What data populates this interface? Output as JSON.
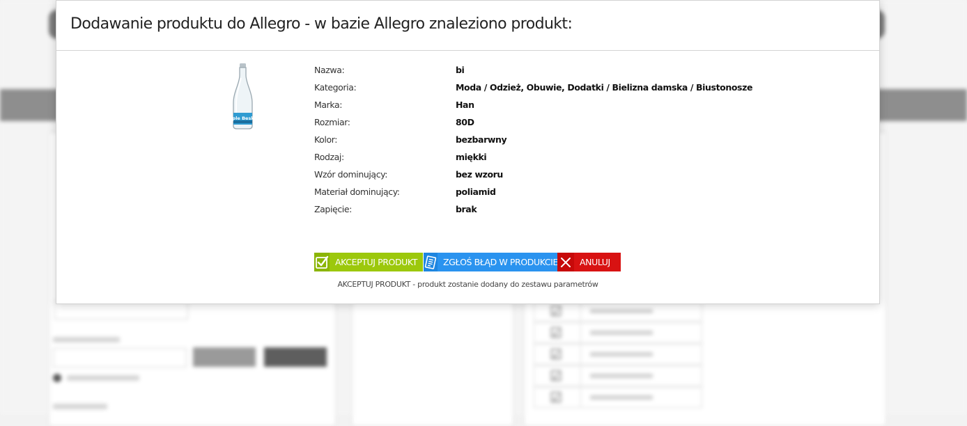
{
  "modal": {
    "title": "Dodawanie produktu do Allegro - w bazie Allegro znaleziono produkt:",
    "product_image_label": "Krople Beskidu",
    "params": [
      {
        "label": "Nazwa:",
        "value": "bi"
      },
      {
        "label": "Kategoria:",
        "value": "Moda / Odzież, Obuwie, Dodatki / Bielizna damska / Biustonosze"
      },
      {
        "label": "Marka:",
        "value": "Han"
      },
      {
        "label": "Rozmiar:",
        "value": "80D"
      },
      {
        "label": "Kolor:",
        "value": "bezbarwny"
      },
      {
        "label": "Rodzaj:",
        "value": "miękki"
      },
      {
        "label": "Wzór dominujący:",
        "value": "bez wzoru"
      },
      {
        "label": "Materiał dominujący:",
        "value": "poliamid"
      },
      {
        "label": "Zapięcie:",
        "value": "brak"
      }
    ],
    "buttons": {
      "accept": {
        "label": "AKCEPTUJ PRODUKT",
        "icon": "checkbox-check-icon",
        "color": "#9cc80c"
      },
      "report": {
        "label": "ZGŁOŚ BŁĄD W PRODUKCIE",
        "icon": "document-list-icon",
        "color": "#2a93ef"
      },
      "cancel": {
        "label": "ANULUJ",
        "icon": "close-x-icon",
        "color": "#d81212"
      }
    },
    "hint": "AKCEPTUJ PRODUKT - produkt zostanie dodany do zestawu parametrów"
  },
  "colors": {
    "accent_green": "#9cc80c",
    "accent_blue": "#2a93ef",
    "accent_red": "#d81212",
    "overlay_band": "#8e8e8e"
  }
}
